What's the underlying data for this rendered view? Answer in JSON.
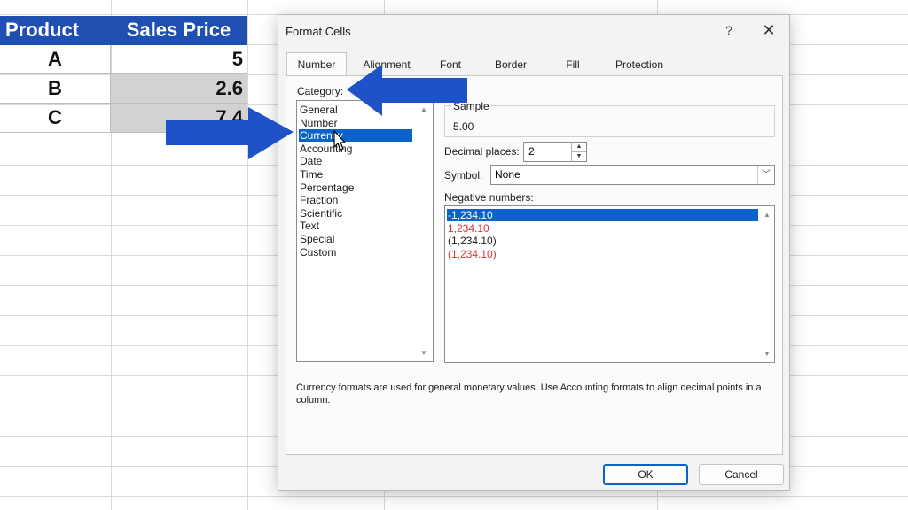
{
  "sheet": {
    "headers": [
      "Product",
      "Sales Price"
    ],
    "rows": [
      {
        "product": "A",
        "price": "5"
      },
      {
        "product": "B",
        "price": "2.6"
      },
      {
        "product": "C",
        "price": "7.4"
      }
    ]
  },
  "dialog": {
    "title": "Format Cells",
    "help_label": "?",
    "close_label": "✕",
    "tabs": [
      "Number",
      "Alignment",
      "Font",
      "Border",
      "Fill",
      "Protection"
    ],
    "active_tab": "Number",
    "category_label": "Category:",
    "categories": [
      "General",
      "Number",
      "Currency",
      "Accounting",
      "Date",
      "Time",
      "Percentage",
      "Fraction",
      "Scientific",
      "Text",
      "Special",
      "Custom"
    ],
    "selected_category": "Currency",
    "sample_label": "Sample",
    "sample_value": "5.00",
    "decimal_label": "Decimal places:",
    "decimal_value": "2",
    "symbol_label": "Symbol:",
    "symbol_value": "None",
    "negative_label": "Negative numbers:",
    "negative_options": [
      {
        "text": "-1,234.10",
        "color": "#ffffff",
        "selected": true
      },
      {
        "text": "1,234.10",
        "color": "#e03131",
        "selected": false
      },
      {
        "text": "(1,234.10)",
        "color": "#1b1b1b",
        "selected": false
      },
      {
        "text": "(1,234.10)",
        "color": "#e03131",
        "selected": false
      }
    ],
    "description": "Currency formats are used for general monetary values.  Use Accounting formats to align decimal points in a column.",
    "ok_label": "OK",
    "cancel_label": "Cancel"
  },
  "colors": {
    "header_blue": "#1f4fb0",
    "selection_blue": "#0b63c9",
    "annotation_arrow": "#1f52c7",
    "negative_red": "#e03131"
  }
}
